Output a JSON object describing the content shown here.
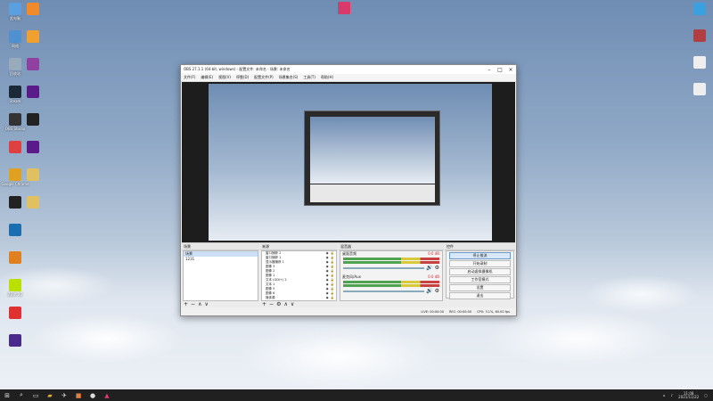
{
  "desktop": {
    "left_icons": [
      {
        "label": "此电脑",
        "color": "#5aa0e0"
      },
      {
        "label": "网络",
        "color": "#4f90d0"
      },
      {
        "label": "回收站",
        "color": "#9ab"
      },
      {
        "label": "Steam",
        "color": "#1b2838"
      },
      {
        "label": "OBS Studio",
        "color": "#333"
      },
      {
        "label": "",
        "color": "#e04040"
      },
      {
        "label": "Google Chrome",
        "color": "#e0a020"
      },
      {
        "label": "",
        "color": "#222"
      },
      {
        "label": "",
        "color": "#1a6fb0"
      },
      {
        "label": "",
        "color": "#e08020"
      },
      {
        "label": "Zwift 22",
        "color": "#bbe000"
      },
      {
        "label": "",
        "color": "#e03030"
      },
      {
        "label": "",
        "color": "#4a2a8a"
      }
    ],
    "second_col_icons": [
      {
        "label": "",
        "color": "#f08a2a"
      },
      {
        "label": "",
        "color": "#f0a030"
      },
      {
        "label": "",
        "color": "#9040a0"
      },
      {
        "label": "",
        "color": "#5a1a8a"
      },
      {
        "label": "",
        "color": "#222"
      },
      {
        "label": "",
        "color": "#5a1a8a"
      },
      {
        "label": "",
        "color": "#e0c060"
      },
      {
        "label": "",
        "color": "#e0c060"
      }
    ],
    "top_center_icon": {
      "label": "",
      "color": "#d83a6a"
    },
    "right_icons": [
      {
        "label": "",
        "color": "#3aa0e0"
      },
      {
        "label": "",
        "color": "#b04040"
      },
      {
        "label": "",
        "color": "#eee"
      },
      {
        "label": "",
        "color": "#eee"
      }
    ]
  },
  "obs": {
    "title": "OBS 27.1.1 (64-bit, windows) - 配置文件: 未命名 - 场景: 未命名",
    "menu": [
      "文件(F)",
      "编辑(E)",
      "视图(V)",
      "停靠(D)",
      "配置文件(P)",
      "场景集合(S)",
      "工具(T)",
      "帮助(H)"
    ],
    "docks": {
      "scenes": {
        "title": "场景",
        "items": [
          "场景",
          "1231"
        ]
      },
      "sources": {
        "title": "来源",
        "items": [
          "窗口捕获 2",
          "窗口捕获 1",
          "显示器捕获 1",
          "图像 3",
          "图像 2",
          "图像 1",
          "文本 (GDI+) 2",
          "文本 1",
          "图像 5",
          "图像 6",
          "媒体源"
        ]
      },
      "mixer": {
        "title": "混音器",
        "channels": [
          {
            "name": "桌面音频",
            "level": "0.0 dB"
          },
          {
            "name": "麦克风/Aux",
            "level": "0.0 dB"
          }
        ]
      },
      "controls": {
        "title": "控件",
        "buttons": [
          "停止推流",
          "开始录制",
          "启动虚拟摄像机",
          "工作室模式",
          "设置",
          "退出"
        ]
      }
    },
    "status": [
      "LIVE: 00:00:00",
      "REC: 00:00:00",
      "CPU: 3.1%, 60.00 fps"
    ]
  },
  "taskbar": {
    "time": "11:08",
    "date": "2021/11/22"
  }
}
